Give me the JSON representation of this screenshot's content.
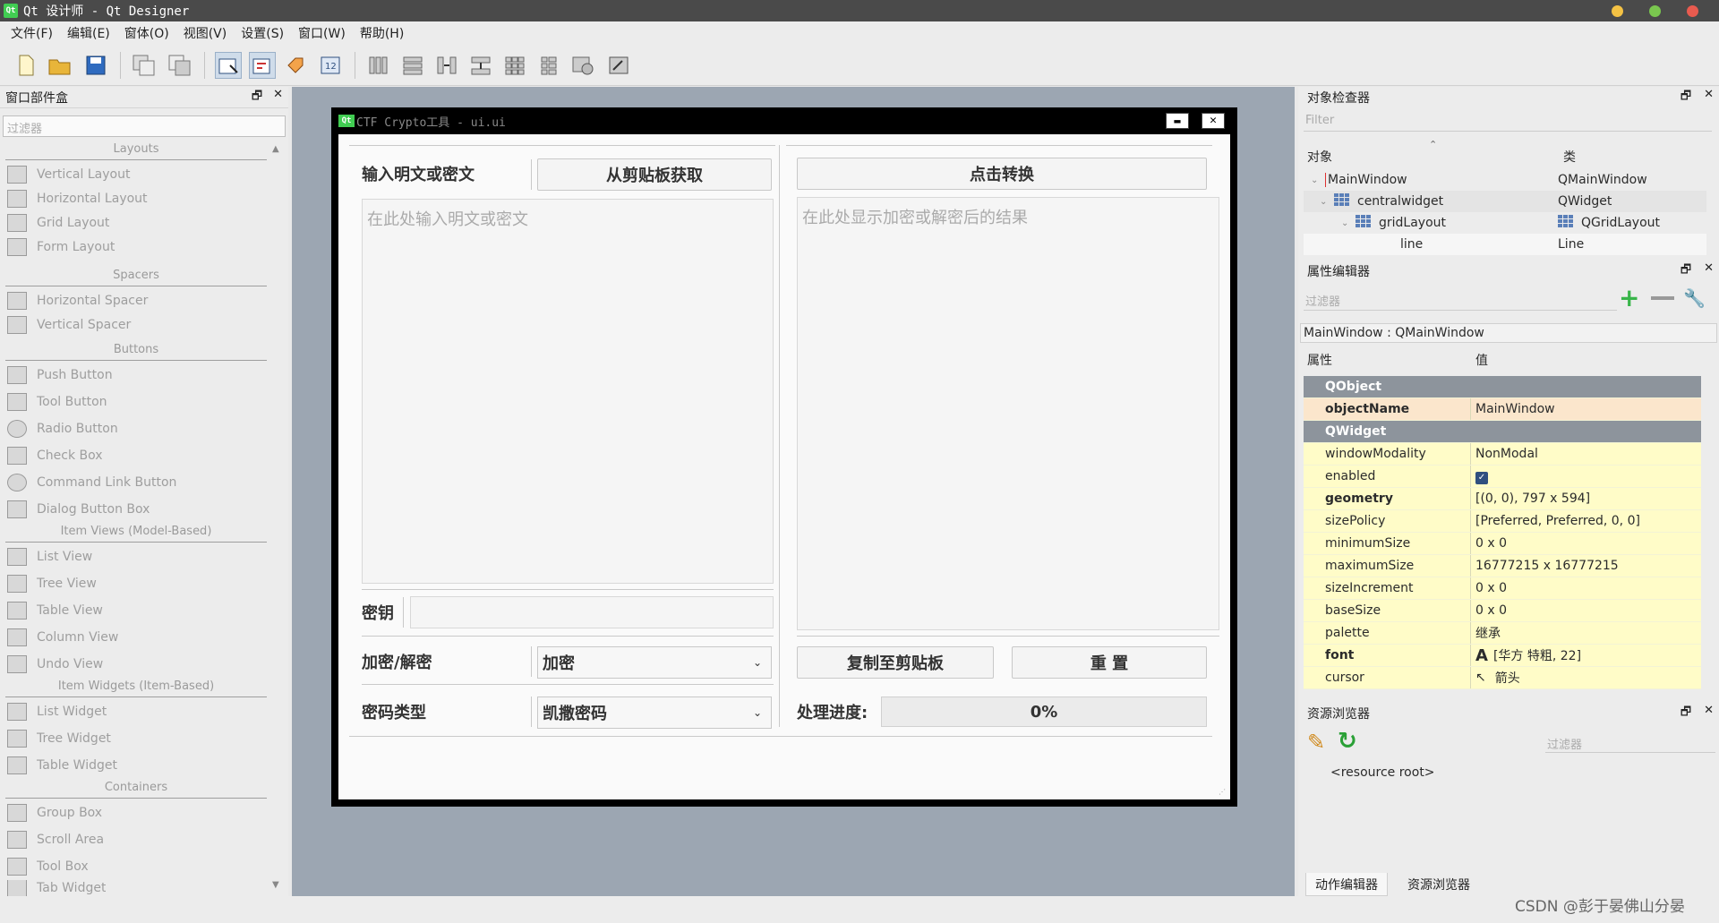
{
  "window": {
    "title": "Qt 设计师 - Qt Designer",
    "app_icon": "Qt"
  },
  "menu": [
    "文件(F)",
    "编辑(E)",
    "窗体(O)",
    "视图(V)",
    "设置(S)",
    "窗口(W)",
    "帮助(H)"
  ],
  "widgetbox": {
    "title": "窗口部件盒",
    "filter_placeholder": "过滤器",
    "cats": {
      "layouts": "Layouts",
      "spacers": "Spacers",
      "buttons": "Buttons",
      "itemviews": "Item Views (Model-Based)",
      "itemwidgets": "Item Widgets (Item-Based)",
      "containers": "Containers"
    },
    "items": {
      "vertical_layout": "Vertical Layout",
      "horizontal_layout": "Horizontal Layout",
      "grid_layout": "Grid Layout",
      "form_layout": "Form Layout",
      "horizontal_spacer": "Horizontal Spacer",
      "vertical_spacer": "Vertical Spacer",
      "push_button": "Push Button",
      "tool_button": "Tool Button",
      "radio_button": "Radio Button",
      "check_box": "Check Box",
      "command_link_button": "Command Link Button",
      "dialog_button_box": "Dialog Button Box",
      "list_view": "List View",
      "tree_view": "Tree View",
      "table_view": "Table View",
      "column_view": "Column View",
      "undo_view": "Undo View",
      "list_widget": "List Widget",
      "tree_widget": "Tree Widget",
      "table_widget": "Table Widget",
      "group_box": "Group Box",
      "scroll_area": "Scroll Area",
      "tool_box": "Tool Box",
      "tab_widget": "Tab Widget"
    }
  },
  "form": {
    "title": "CTF Crypto工具 - ui.ui",
    "title_icon": "Qt",
    "input_label": "输入明文或密文",
    "paste_button": "从剪贴板获取",
    "convert_button": "点击转换",
    "input_placeholder": "在此处输入明文或密文",
    "output_placeholder": "在此处显示加密或解密后的结果",
    "key_label": "密钥",
    "mode_label": "加密/解密",
    "mode_value": "加密",
    "type_label": "密码类型",
    "type_value": "凯撒密码",
    "copy_button": "复制至剪贴板",
    "reset_button": "重 置",
    "progress_label": "处理进度:",
    "progress_text": "0%",
    "progress_value": 0
  },
  "object_inspector": {
    "title": "对象检查器",
    "filter_placeholder": "Filter",
    "col_object": "对象",
    "col_class": "类",
    "rows": [
      {
        "name": "MainWindow",
        "cls": "QMainWindow"
      },
      {
        "name": "centralwidget",
        "cls": "QWidget"
      },
      {
        "name": "gridLayout",
        "cls": "QGridLayout"
      },
      {
        "name": "line",
        "cls": "Line"
      }
    ]
  },
  "property_editor": {
    "title": "属性编辑器",
    "filter_placeholder": "过滤器",
    "context": "MainWindow : QMainWindow",
    "col_prop": "属性",
    "col_value": "值",
    "groups": {
      "qobject": "QObject",
      "qwidget": "QWidget"
    },
    "props": {
      "objectName": {
        "name": "objectName",
        "value": "MainWindow"
      },
      "windowModality": {
        "name": "windowModality",
        "value": "NonModal"
      },
      "enabled": {
        "name": "enabled",
        "value": ""
      },
      "geometry": {
        "name": "geometry",
        "value": "[(0, 0), 797 x 594]"
      },
      "sizePolicy": {
        "name": "sizePolicy",
        "value": "[Preferred, Preferred, 0, 0]"
      },
      "minimumSize": {
        "name": "minimumSize",
        "value": "0 x 0"
      },
      "maximumSize": {
        "name": "maximumSize",
        "value": "16777215 x 16777215"
      },
      "sizeIncrement": {
        "name": "sizeIncrement",
        "value": "0 x 0"
      },
      "baseSize": {
        "name": "baseSize",
        "value": "0 x 0"
      },
      "palette": {
        "name": "palette",
        "value": "继承"
      },
      "font": {
        "name": "font",
        "value": "[华方 特粗, 22]"
      },
      "cursor": {
        "name": "cursor",
        "value": "箭头"
      }
    }
  },
  "resource_browser": {
    "title": "资源浏览器",
    "filter_placeholder": "过滤器",
    "root": "<resource root>"
  },
  "bottom_tabs": [
    "动作编辑器",
    "资源浏览器"
  ],
  "watermark": "CSDN @彭于晏佛山分晏",
  "colors": {
    "accent": "#41cd52",
    "group_bg": "#8d949c",
    "prop_yellow": "#fffcc8",
    "mdi_bg": "#9ca6b2"
  }
}
